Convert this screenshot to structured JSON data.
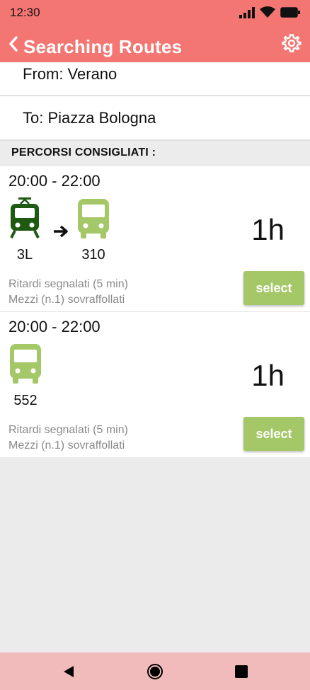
{
  "status_bar": {
    "time": "12:30"
  },
  "app_bar": {
    "title": "Searching Routes"
  },
  "search": {
    "from": "From: Verano",
    "to": "To: Piazza Bologna"
  },
  "section": {
    "label": "PERCORSI CONSIGLIATI :"
  },
  "routes": [
    {
      "time_range": "20:00 - 22:00",
      "duration": "1h",
      "legs": [
        {
          "icon": "tram-icon",
          "line": "3L",
          "color": "#1e5a12"
        },
        {
          "icon": "bus-icon",
          "line": "310",
          "color": "#a4c767"
        }
      ],
      "note_1": "Ritardi segnalati (5 min)",
      "note_2": "Mezzi (n.1) sovraffollati",
      "select_label": "select"
    },
    {
      "time_range": "20:00 - 22:00",
      "duration": "1h",
      "legs": [
        {
          "icon": "bus-icon",
          "line": "552",
          "color": "#a4c767"
        }
      ],
      "note_1": "Ritardi segnalati (5 min)",
      "note_2": "Mezzi (n.1) sovraffollati",
      "select_label": "select"
    }
  ],
  "colors": {
    "app_bar": "#f47672",
    "accent_green": "#a4c767",
    "tram_green": "#1e5a12",
    "nav_bar": "#f2bbbb"
  }
}
